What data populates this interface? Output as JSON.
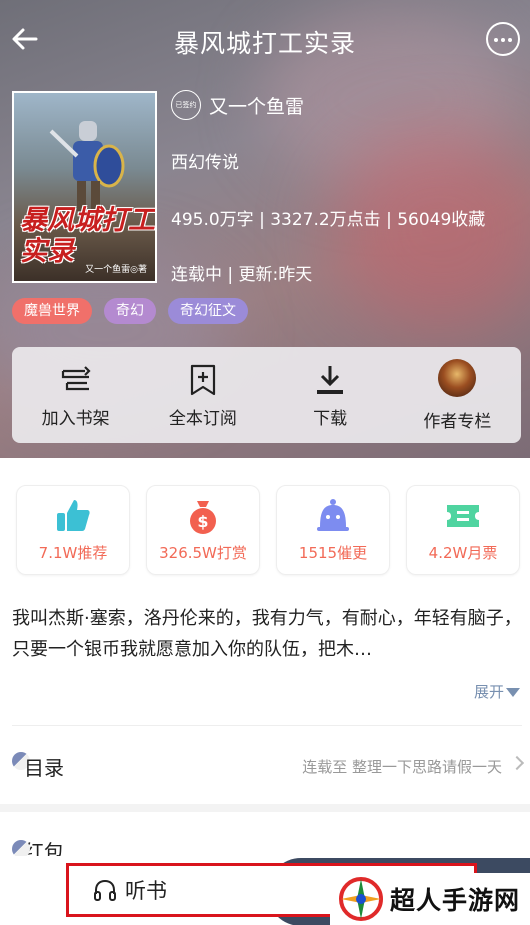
{
  "header": {
    "title": "暴风城打工实录"
  },
  "book": {
    "cover_title": "暴风城打工实录",
    "cover_author": "又一个鱼雷◎著",
    "signed_badge": "已签约",
    "author": "又一个鱼雷",
    "genre": "西幻传说",
    "stats_line": "495.0万字 | 3327.2万点击 | 56049收藏",
    "status_line": "连载中 | 更新:昨天"
  },
  "tags": [
    {
      "label": "魔兽世界",
      "color": "#f0706a"
    },
    {
      "label": "奇幻",
      "color": "#b48ad0"
    },
    {
      "label": "奇幻征文",
      "color": "#9b8bd8"
    }
  ],
  "actions": [
    {
      "label": "加入书架",
      "icon": "bookshelf-add-icon"
    },
    {
      "label": "全本订阅",
      "icon": "subscribe-icon"
    },
    {
      "label": "下载",
      "icon": "download-icon"
    },
    {
      "label": "作者专栏",
      "icon": "author-avatar"
    }
  ],
  "stats": [
    {
      "label": "7.1W推荐",
      "icon": "thumbs-up-icon",
      "color": "#3cc0d4"
    },
    {
      "label": "326.5W打赏",
      "icon": "money-bag-icon",
      "color": "#f2604f"
    },
    {
      "label": "1515催更",
      "icon": "bell-icon",
      "color": "#7d8cf0"
    },
    {
      "label": "4.2W月票",
      "icon": "ticket-icon",
      "color": "#4fd4a0"
    }
  ],
  "description": "我叫杰斯·塞索，洛丹伦来的，我有力气，有耐心，年轻有脑子，只要一个银币我就愿意加入你的队伍，把木…",
  "expand_label": "展开",
  "toc": {
    "title": "目录",
    "latest": "连载至 整理一下思路请假一天"
  },
  "red_packet_label": "红包",
  "bottom": {
    "listen_label": "听书"
  },
  "brand": {
    "name": "超人手游网"
  }
}
